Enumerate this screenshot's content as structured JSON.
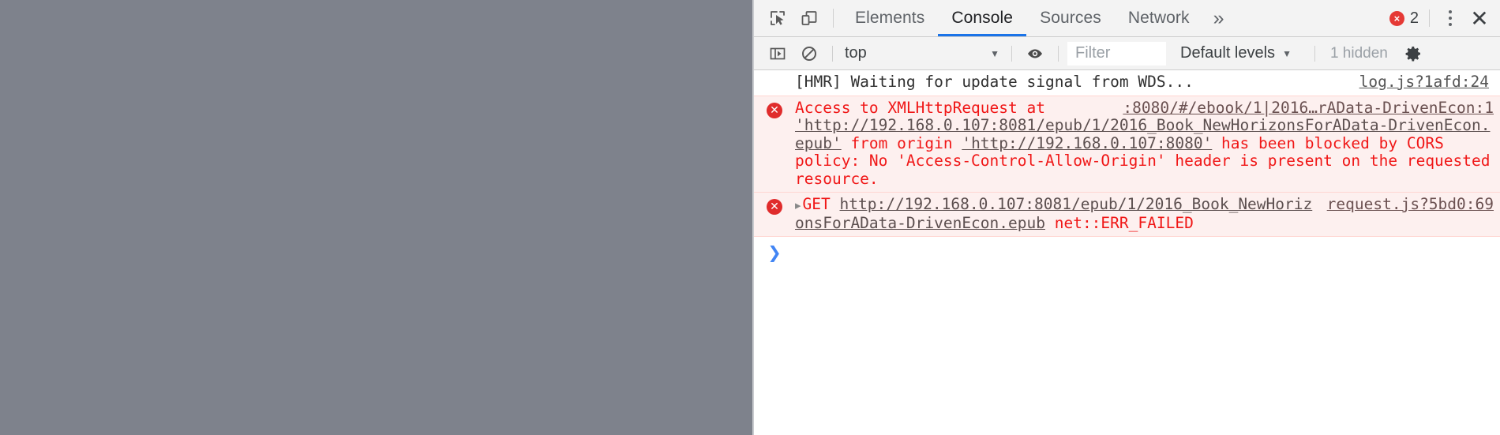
{
  "page": {
    "background_color": "#7e828c"
  },
  "devtools": {
    "toolbar": {
      "inspect_icon": "inspect-element-icon",
      "device_icon": "device-toolbar-icon",
      "tabs": [
        {
          "label": "Elements",
          "selected": false
        },
        {
          "label": "Console",
          "selected": true
        },
        {
          "label": "Sources",
          "selected": false
        },
        {
          "label": "Network",
          "selected": false
        }
      ],
      "more_tabs_icon": "»",
      "error_count": "2",
      "error_badge_glyph": "×",
      "menu_icon": "kebab-menu-icon",
      "close_icon": "✕",
      "accent_color": "#1a73e8",
      "error_color": "#e53935"
    },
    "filterbar": {
      "sidebar_icon": "console-sidebar-icon",
      "clear_icon": "clear-console-icon",
      "context": "top",
      "context_caret": "▼",
      "eye_icon": "live-expression-icon",
      "filter_placeholder": "Filter",
      "filter_value": "",
      "levels_label": "Default levels",
      "levels_caret": "▼",
      "hidden_label": "1 hidden",
      "settings_icon": "gear-icon"
    },
    "console": {
      "messages": [
        {
          "type": "info",
          "text": "[HMR] Waiting for update signal from WDS...",
          "source": "log.js?1afd:24"
        },
        {
          "type": "error",
          "source": "​:8080/#/ebook/1|2016…rAData-DrivenEcon:1",
          "segments": [
            {
              "kind": "text",
              "value": "Access to XMLHttpRequest at "
            },
            {
              "kind": "url",
              "value": "'http://192.168.0.107:8081/epub/1/2016_Book_NewHorizonsForAData-DrivenEcon.epub'"
            },
            {
              "kind": "text",
              "value": " from origin "
            },
            {
              "kind": "url",
              "value": "'http://192.168.0.107:8080'"
            },
            {
              "kind": "text",
              "value": " has been blocked by CORS policy: No 'Access-Control-Allow-Origin' header is present on the requested resource."
            }
          ]
        },
        {
          "type": "error",
          "expander": "▸",
          "source": "request.js?5bd0:69",
          "segments": [
            {
              "kind": "text",
              "value": "GET "
            },
            {
              "kind": "url",
              "value": "http://192.168.0.107:8081/epub/1/2016_Book_NewHorizonsForAData-DrivenEcon.epub"
            },
            {
              "kind": "text",
              "value": " net::ERR_FAILED"
            }
          ]
        }
      ],
      "prompt_glyph": "❯",
      "prompt_value": ""
    }
  }
}
